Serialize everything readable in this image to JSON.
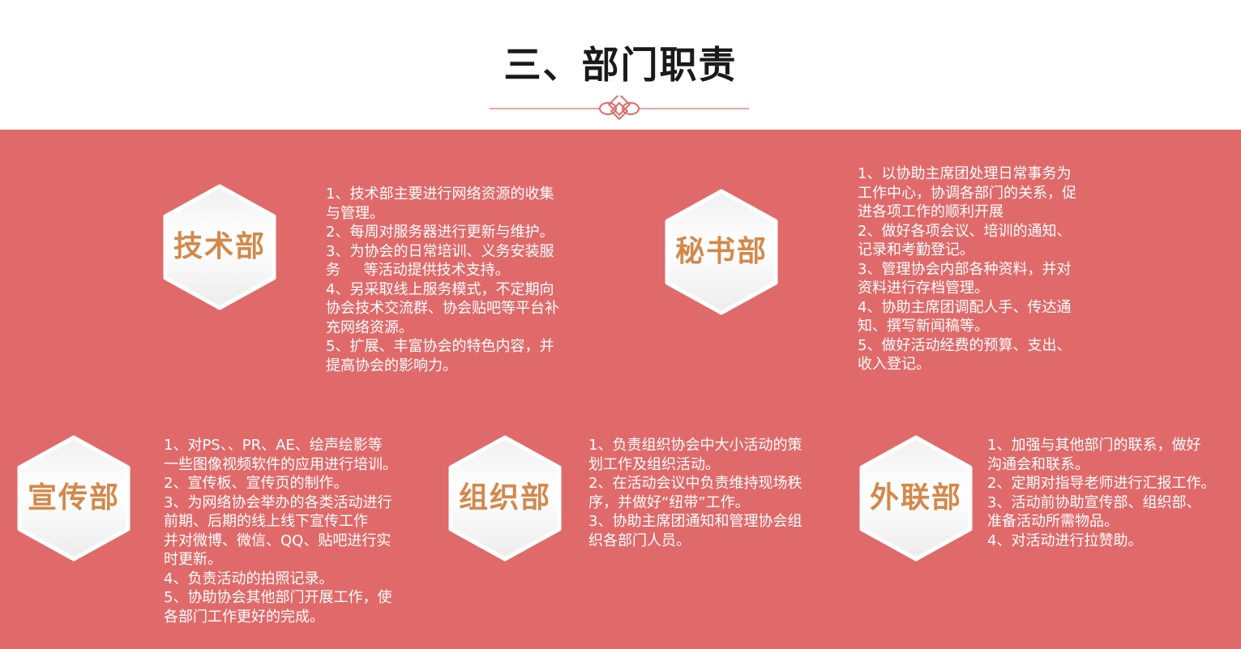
{
  "title": "三、部门职责",
  "colors": {
    "band": "#e06a6a",
    "hex_label": "#d4884a",
    "divider": "#e06a6a"
  },
  "departments": [
    {
      "name": "技术部",
      "items": [
        "1、技术部主要进行网络资源的收集\n与管理。",
        "2、每周对服务器进行更新与维护。",
        "3、为协会的日常培训、义务安装服\n务     等活动提供技术支持。",
        "4、另采取线上服务模式，不定期向\n协会技术交流群、协会贴吧等平台补\n充网络资源。",
        "5、扩展、丰富协会的特色内容，并\n提高协会的影响力。"
      ]
    },
    {
      "name": "秘书部",
      "items": [
        "1、以协助主席团处理日常事务为\n工作中心，协调各部门的关系，促\n进各项工作的顺利开展",
        "2、做好各项会议、培训的通知、\n记录和考勤登记。",
        "3、管理协会内部各种资料，并对\n资料进行存档管理。",
        "4、协助主席团调配人手、传达通\n知、撰写新闻稿等。",
        "5、做好活动经费的预算、支出、\n收入登记。"
      ]
    },
    {
      "name": "宣传部",
      "items": [
        "1、对PS、、PR、AE、绘声绘影等\n一些图像视频软件的应用进行培训。",
        "2、宣传板、宣传页的制作。",
        "3、为网络协会举办的各类活动进行\n前期、后期的线上线下宣传工作\n并对微博、微信、QQ、贴吧进行实\n时更新。",
        "4、负责活动的拍照记录。",
        "5、协助协会其他部门开展工作，使\n各部门工作更好的完成。"
      ]
    },
    {
      "name": "组织部",
      "items": [
        "1、负责组织协会中大小活动的策\n划工作及组织活动。",
        "2、在活动会议中负责维持现场秩\n序，并做好“纽带”工作。",
        "3、协助主席团通知和管理协会组\n织各部门人员。"
      ]
    },
    {
      "name": "外联部",
      "items": [
        "1、加强与其他部门的联系，做好\n沟通会和联系。",
        "2、定期对指导老师进行汇报工作。",
        "3、活动前协助宣传部、组织部、\n准备活动所需物品。",
        "4、对活动进行拉赞助。"
      ]
    }
  ]
}
